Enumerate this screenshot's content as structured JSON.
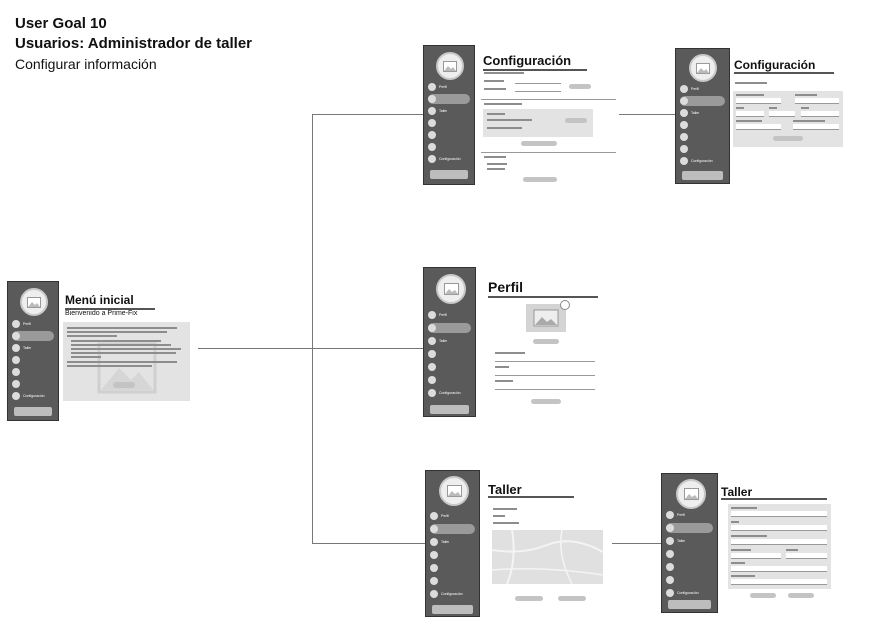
{
  "header": {
    "line1": "User Goal 10",
    "line2": "Usuarios: Administrador de taller",
    "line3": "Configurar información"
  },
  "screens": {
    "menu": {
      "title": "Menú inicial",
      "subtitle": "Bienvenido a Prime-Fix"
    },
    "config1": {
      "title": "Configuración"
    },
    "config2": {
      "title": "Configuración"
    },
    "perfil": {
      "title": "Perfil"
    },
    "taller1": {
      "title": "Taller"
    },
    "taller2": {
      "title": "Taller"
    }
  },
  "colors": {
    "sidebar": "#5a5a5a",
    "panel": "#e3e3e3",
    "connector": "#777777"
  },
  "icons": [
    "avatar-image-icon",
    "nav-bullet-icon",
    "image-placeholder-icon"
  ]
}
